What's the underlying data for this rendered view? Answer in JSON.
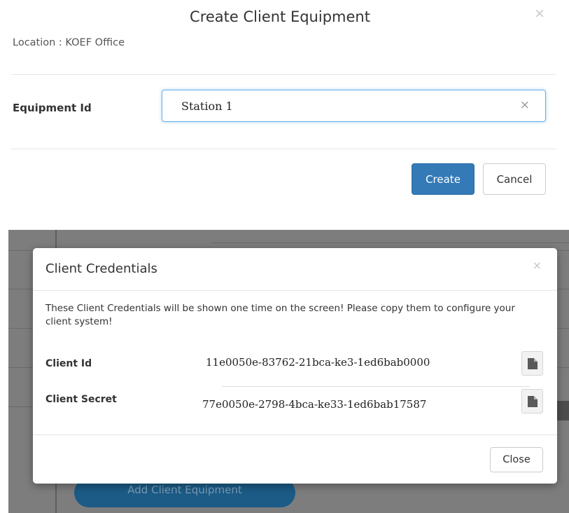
{
  "create_modal": {
    "title": "Create Client Equipment",
    "close_symbol": "×",
    "location_text": "Location : KOEF Office",
    "equipment_label": "Equipment Id",
    "equipment_value": "Station 1",
    "clear_symbol": "×",
    "create_label": "Create",
    "cancel_label": "Cancel"
  },
  "background_app": {
    "add_button_label": "Add Client Equipment"
  },
  "credentials_modal": {
    "title": "Client Credentials",
    "close_symbol": "×",
    "message": "These Client Credentials will be shown one time on the screen! Please copy them to configure your client system!",
    "client_id_label": "Client Id",
    "client_id_value": "11e0050e-83762-21bca-ke3-1ed6bab0000",
    "client_secret_label": "Client Secret",
    "client_secret_value": "77e0050e-2798-4bca-ke33-1ed6bab17587",
    "copy_icon": "file-copy-icon",
    "close_label": "Close"
  },
  "colors": {
    "primary": "#337ab7",
    "overlay": "#7d7d7d",
    "add_button": "#1b5b86"
  }
}
